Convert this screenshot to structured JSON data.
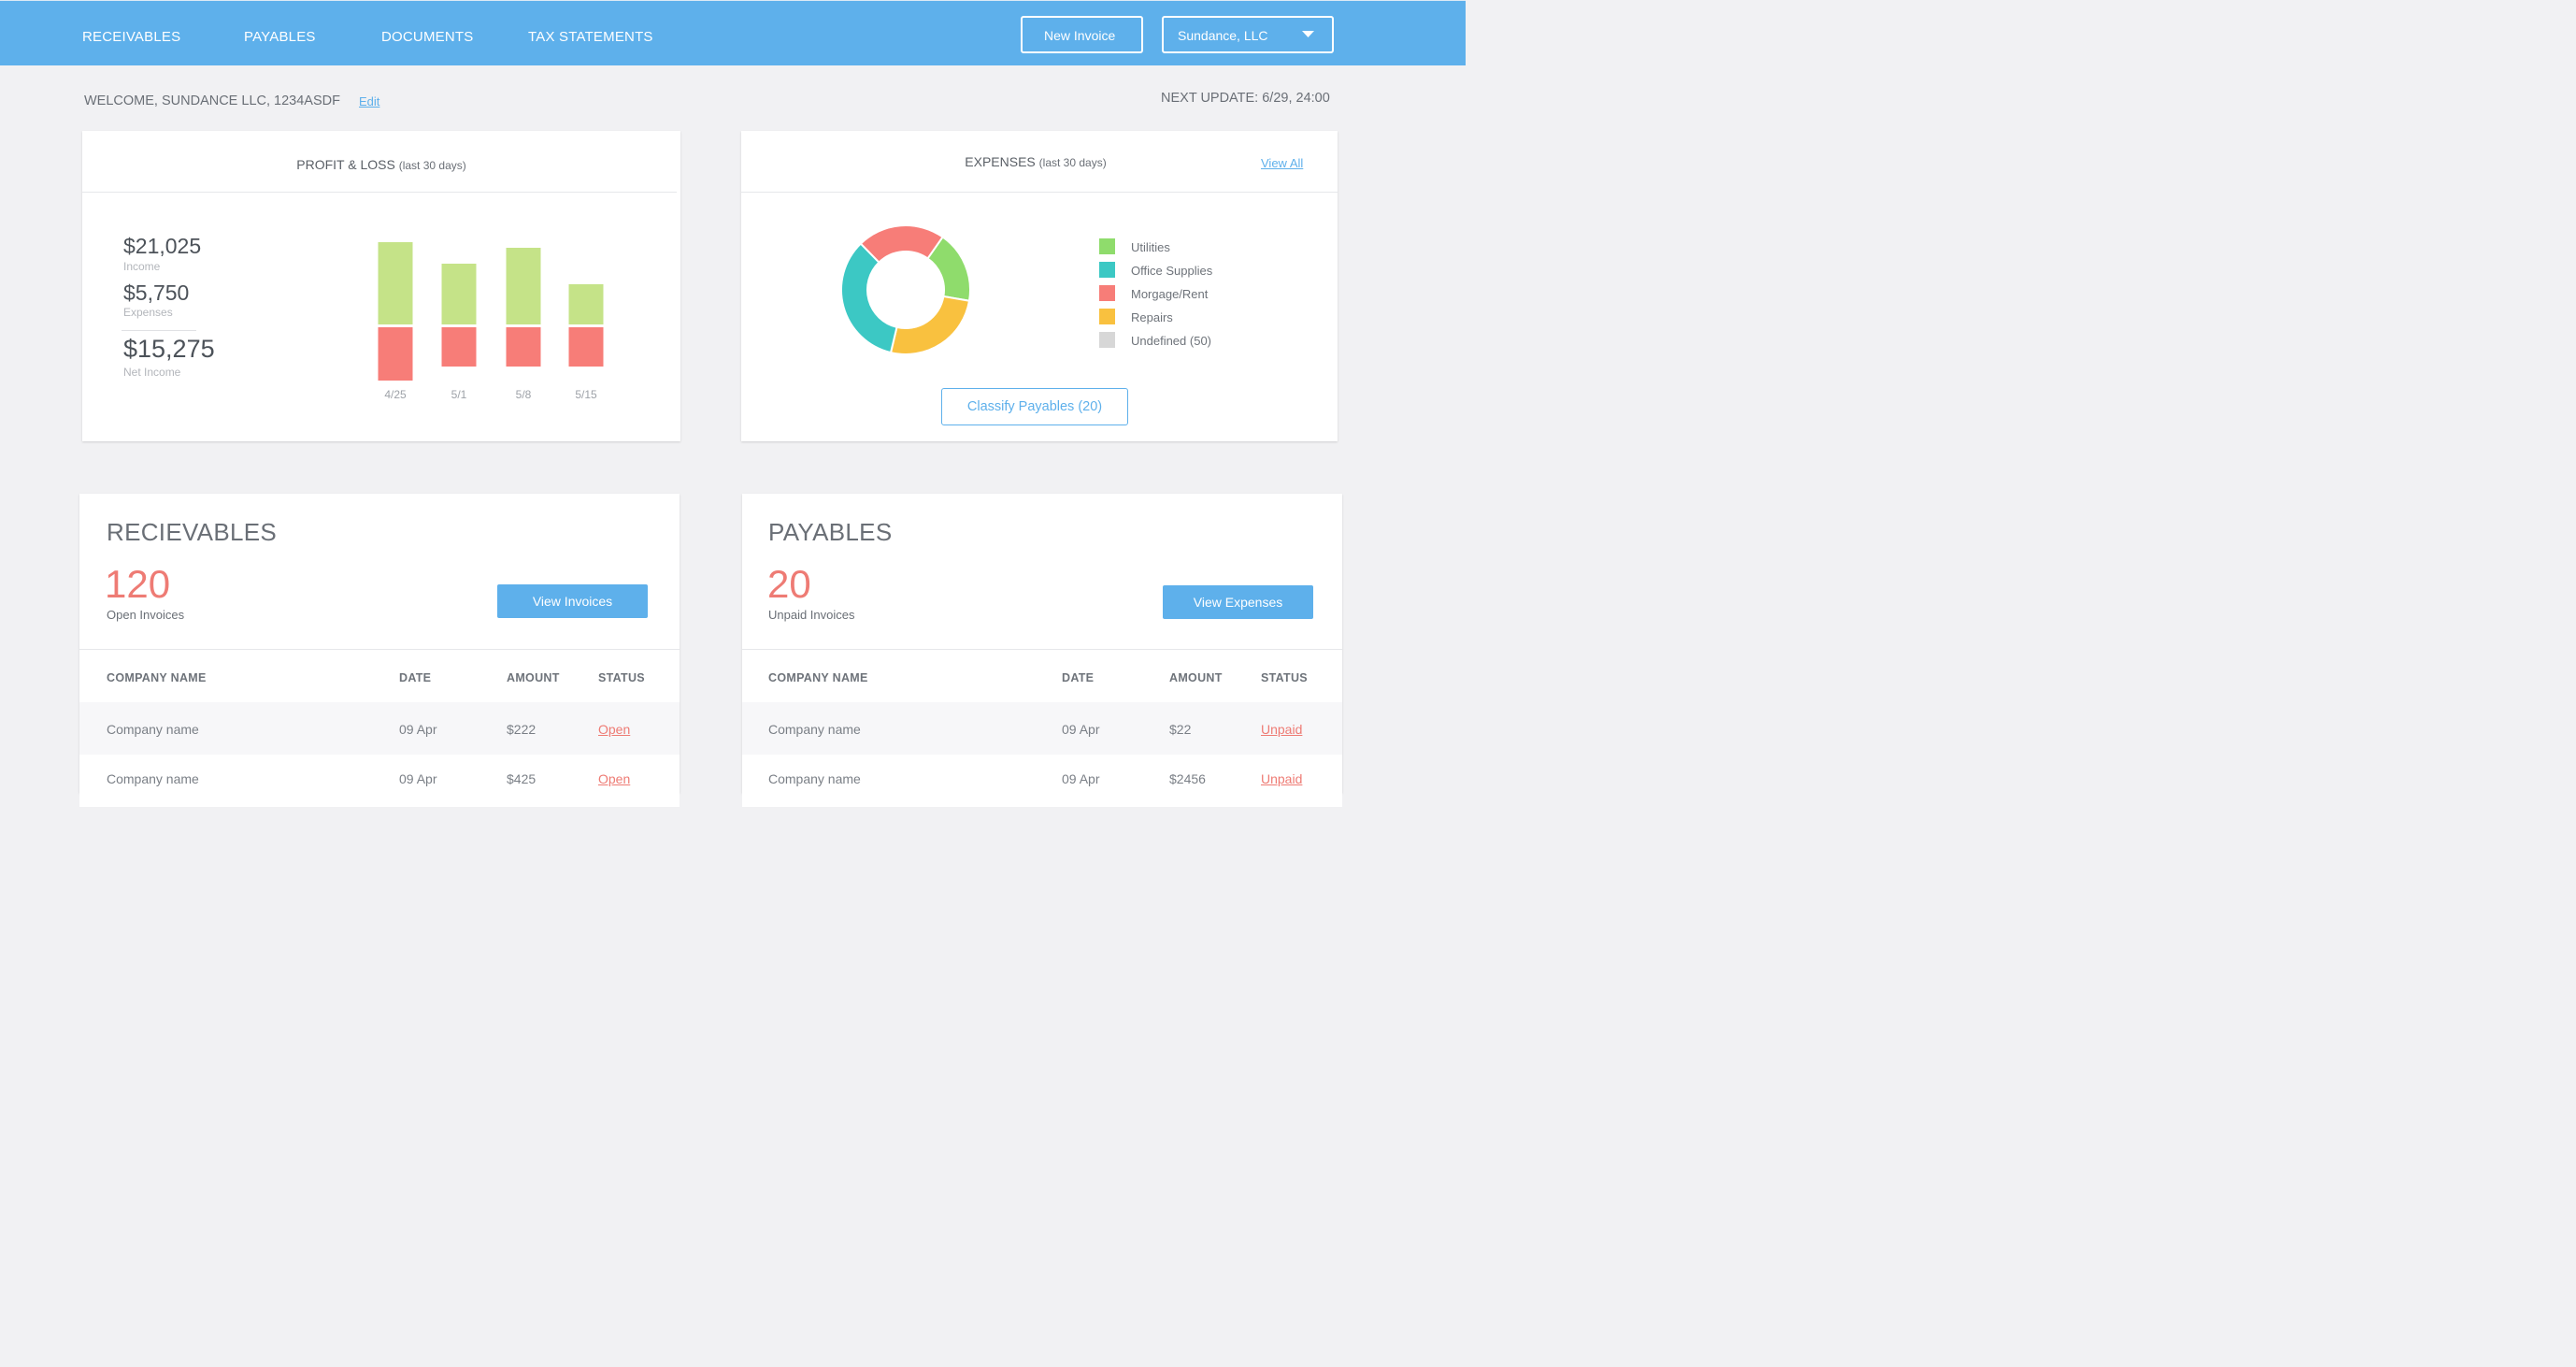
{
  "nav": {
    "items": [
      "RECEIVABLES",
      "PAYABLES",
      "DOCUMENTS",
      "TAX STATEMENTS"
    ],
    "new_invoice_label": "New Invoice",
    "account_label": "Sundance, LLC"
  },
  "welcome": {
    "text": "WELCOME, SUNDANCE LLC, 1234ASDF",
    "edit_label": "Edit",
    "next_update": "NEXT UPDATE: 6/29, 24:00"
  },
  "profit_loss": {
    "title": "PROFIT & LOSS",
    "subtitle": "(last 30 days)",
    "income_value": "$21,025",
    "income_label": "Income",
    "expenses_value": "$5,750",
    "expenses_label": "Expenses",
    "net_value": "$15,275",
    "net_label": "Net Income"
  },
  "expenses_panel": {
    "title": "EXPENSES",
    "subtitle": "(last 30 days)",
    "view_all_label": "View All",
    "classify_label": "Classify Payables (20)"
  },
  "receivables": {
    "title": "RECIEVABLES",
    "count": "120",
    "count_label": "Open Invoices",
    "button_label": "View Invoices",
    "columns": [
      "COMPANY NAME",
      "DATE",
      "AMOUNT",
      "STATUS"
    ],
    "rows": [
      {
        "company": "Company name",
        "date": "09 Apr",
        "amount": "$222",
        "status": "Open"
      },
      {
        "company": "Company name",
        "date": "09 Apr",
        "amount": "$425",
        "status": "Open"
      }
    ]
  },
  "payables": {
    "title": "PAYABLES",
    "count": "20",
    "count_label": "Unpaid Invoices",
    "button_label": "View Expenses",
    "columns": [
      "COMPANY NAME",
      "DATE",
      "AMOUNT",
      "STATUS"
    ],
    "rows": [
      {
        "company": "Company name",
        "date": "09 Apr",
        "amount": "$22",
        "status": "Unpaid"
      },
      {
        "company": "Company name",
        "date": "09 Apr",
        "amount": "$2456",
        "status": "Unpaid"
      }
    ]
  },
  "colors": {
    "brand_blue": "#5eb0eb",
    "income_green": "#c5e388",
    "expense_red": "#f77d78",
    "utilities": "#8fdc6c",
    "office_supplies": "#3cc8c4",
    "mortgage_rent": "#f77d78",
    "repairs": "#f9c13f",
    "undefined": "#d7d7d7",
    "status_red": "#ee7b74"
  },
  "chart_data": [
    {
      "type": "bar",
      "title": "PROFIT & LOSS (last 30 days)",
      "categories": [
        "4/25",
        "5/1",
        "5/8",
        "5/15"
      ],
      "series": [
        {
          "name": "Income",
          "values": [
            88,
            65,
            82,
            43
          ]
        },
        {
          "name": "Expenses",
          "values": [
            57,
            42,
            42,
            42
          ]
        }
      ],
      "stacked": "diverging",
      "grid": false
    },
    {
      "type": "pie",
      "title": "EXPENSES (last 30 days)",
      "donut": true,
      "slices": [
        {
          "name": "Utilities",
          "value": 18
        },
        {
          "name": "Repairs",
          "value": 26
        },
        {
          "name": "Office Supplies",
          "value": 34
        },
        {
          "name": "Morgage/Rent",
          "value": 22
        }
      ],
      "legend": [
        "Utilities",
        "Office Supplies",
        "Morgage/Rent",
        "Repairs",
        "Undefined (50)"
      ],
      "legend_position": "right"
    }
  ]
}
